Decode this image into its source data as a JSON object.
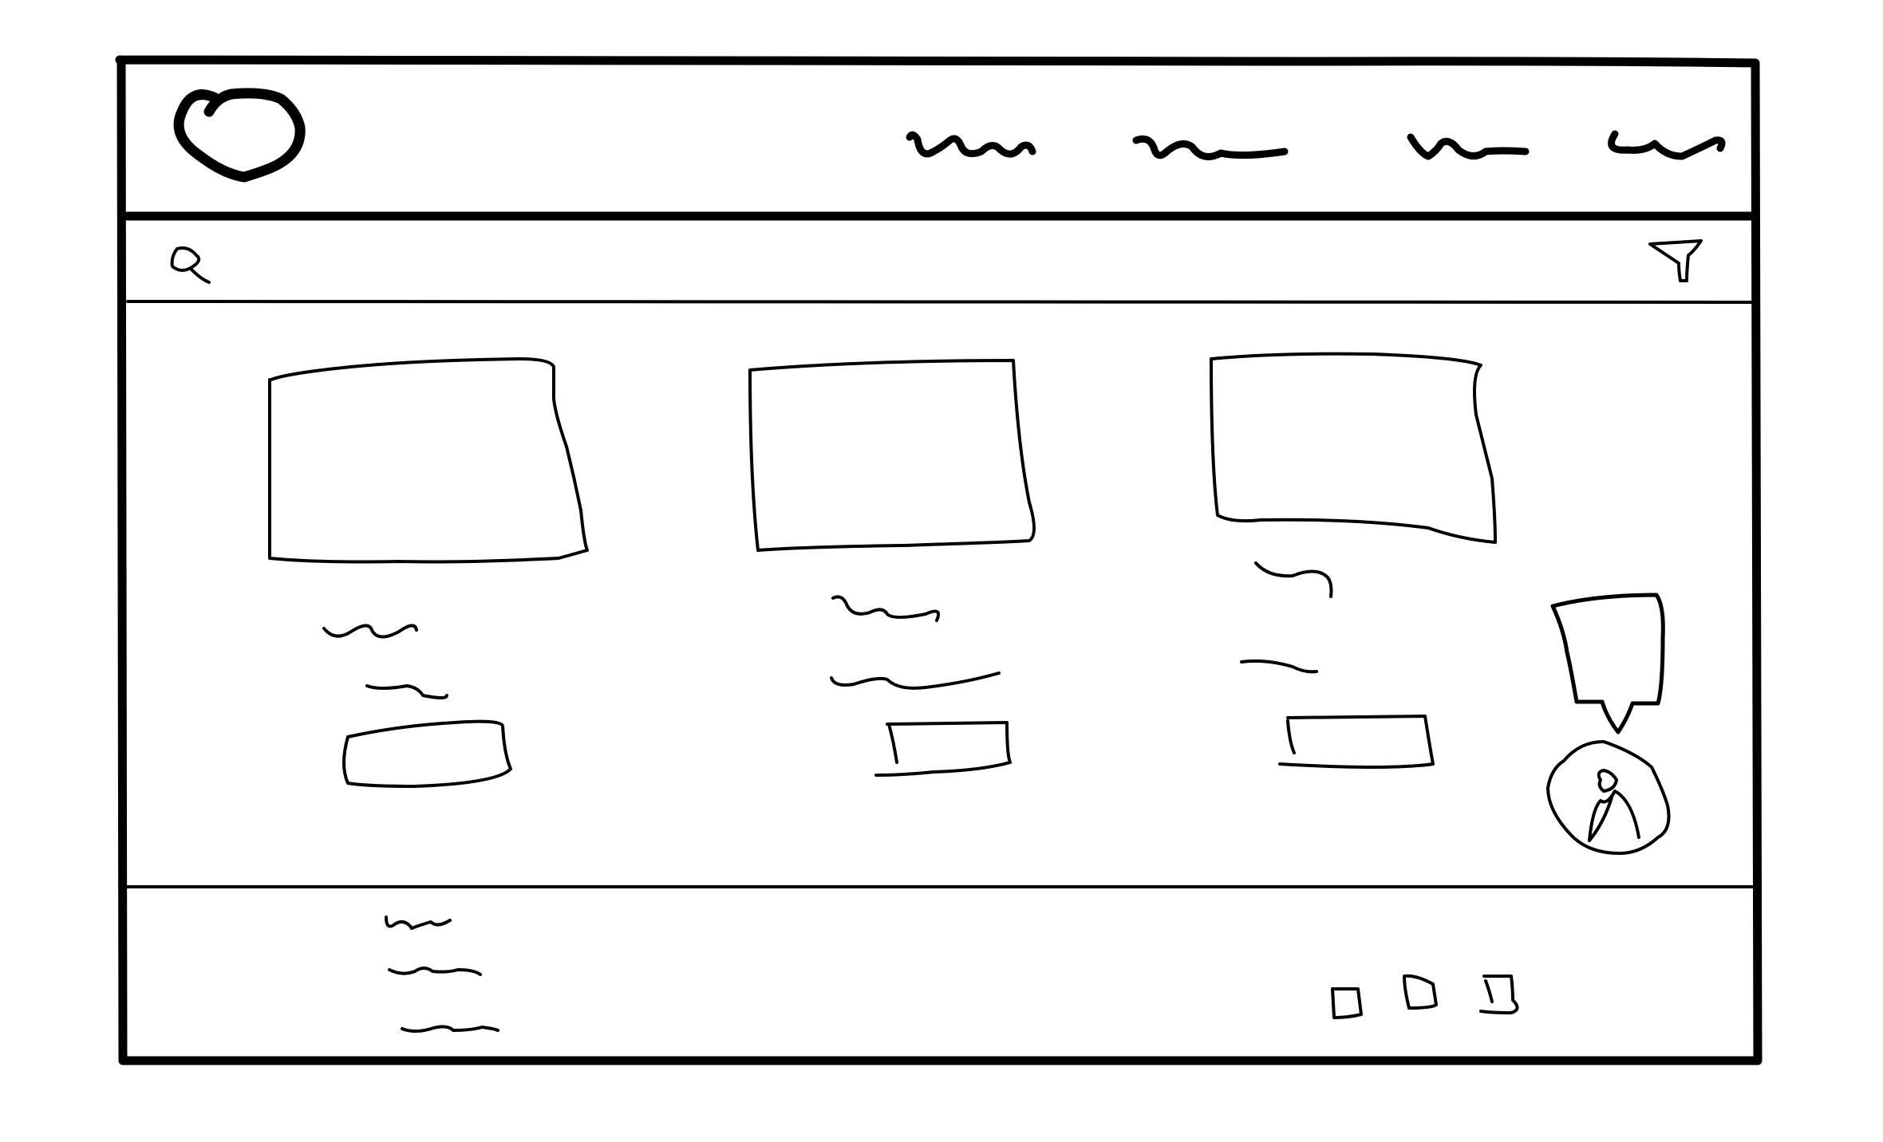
{
  "app": {
    "kind": "hand-drawn wireframe"
  },
  "header": {
    "logo_icon": "logo-blob",
    "nav_items": [
      "nav-scribble-1",
      "nav-scribble-2",
      "nav-scribble-3",
      "nav-scribble-4"
    ]
  },
  "toolbar": {
    "search_icon": "search-icon",
    "filter_icon": "filter-icon"
  },
  "cards": [
    {
      "image_icon": "image-placeholder",
      "lines": 2,
      "button": "button-placeholder"
    },
    {
      "image_icon": "image-placeholder",
      "lines": 2,
      "button": "button-placeholder"
    },
    {
      "image_icon": "image-placeholder",
      "lines": 2,
      "button": "button-placeholder"
    }
  ],
  "floating": {
    "chat_icon": "chat-bubble-icon",
    "avatar_icon": "user-avatar-icon"
  },
  "footer": {
    "text_lines": 3,
    "icons": [
      "square-icon",
      "document-icon",
      "folder-icon"
    ]
  }
}
